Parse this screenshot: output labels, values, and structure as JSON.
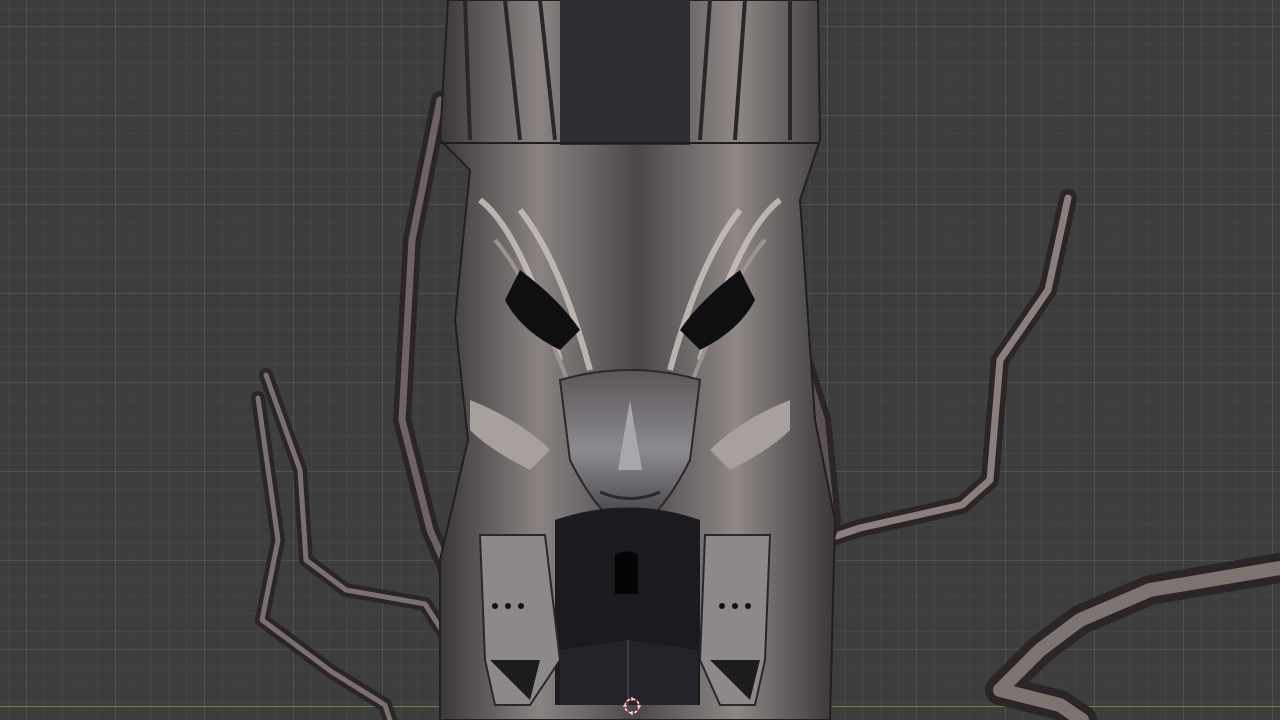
{
  "viewport": {
    "mode": "3D Viewport",
    "axis_color": "#6a8a3a",
    "background_color": "#3d3d3d"
  },
  "scene_object": {
    "description_icon": "gothic-mask-tower-model",
    "material_colors": {
      "stone_dark": "#2e2c2f",
      "stone_mid": "#6a6568",
      "stone_light": "#b7b0aa",
      "root_brown": "#4a3d3f"
    }
  },
  "cursor_icon": "3d-cursor-icon"
}
